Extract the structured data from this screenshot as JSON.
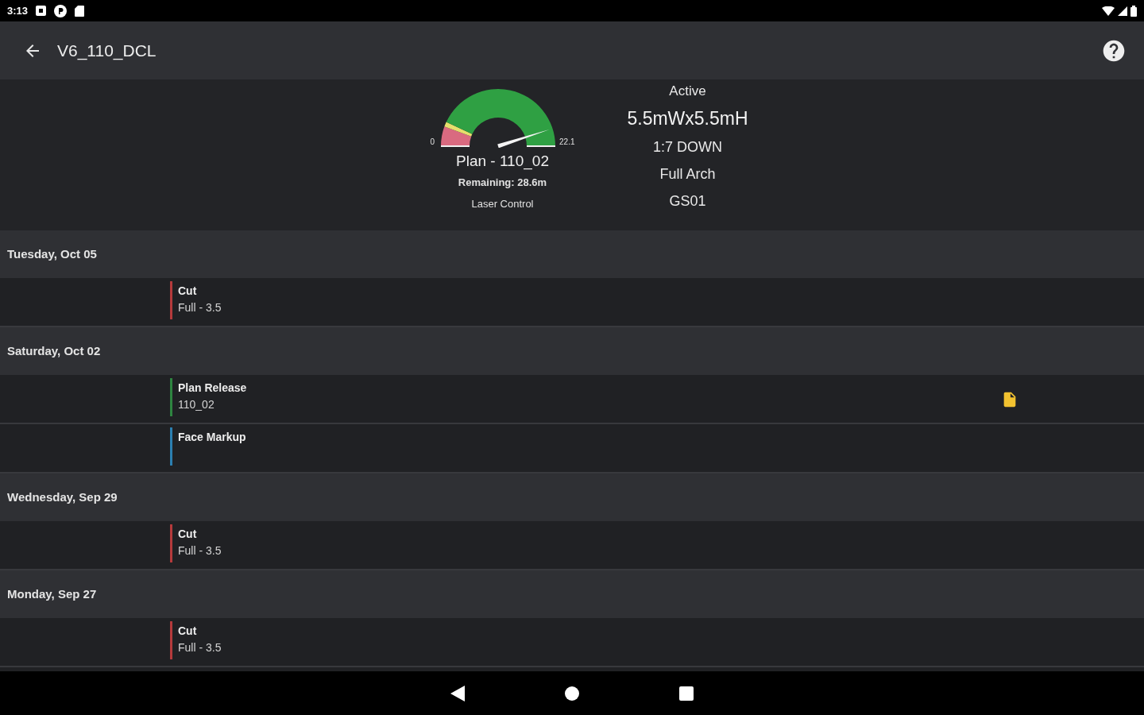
{
  "status_bar": {
    "time": "3:13"
  },
  "app_bar": {
    "title": "V6_110_DCL"
  },
  "summary": {
    "gauge": {
      "min": "0",
      "max": "22.1",
      "level": 0.9
    },
    "plan": "Plan - 110_02",
    "remaining": "Remaining: 28.6m",
    "mode": "Laser Control",
    "status": "Active",
    "size": "5.5mWx5.5mH",
    "slope": "1:7 DOWN",
    "coverage": "Full Arch",
    "code": "GS01"
  },
  "days": [
    {
      "date": "Tuesday, Oct 05",
      "events": [
        {
          "title": "Cut",
          "detail": "Full - 3.5",
          "color": "#b53a3c",
          "attachment": false
        }
      ]
    },
    {
      "date": "Saturday, Oct 02",
      "events": [
        {
          "title": "Plan Release",
          "detail": "110_02",
          "color": "#2e8540",
          "attachment": true
        },
        {
          "title": "Face Markup",
          "color": "#2b7fb0",
          "attachment": false
        }
      ]
    },
    {
      "date": "Wednesday, Sep 29",
      "events": [
        {
          "title": "Cut",
          "detail": "Full - 3.5",
          "color": "#b53a3c",
          "attachment": false
        }
      ]
    },
    {
      "date": "Monday, Sep 27",
      "events": [
        {
          "title": "Cut",
          "detail": "Full - 3.5",
          "color": "#b53a3c",
          "attachment": false
        }
      ]
    }
  ]
}
